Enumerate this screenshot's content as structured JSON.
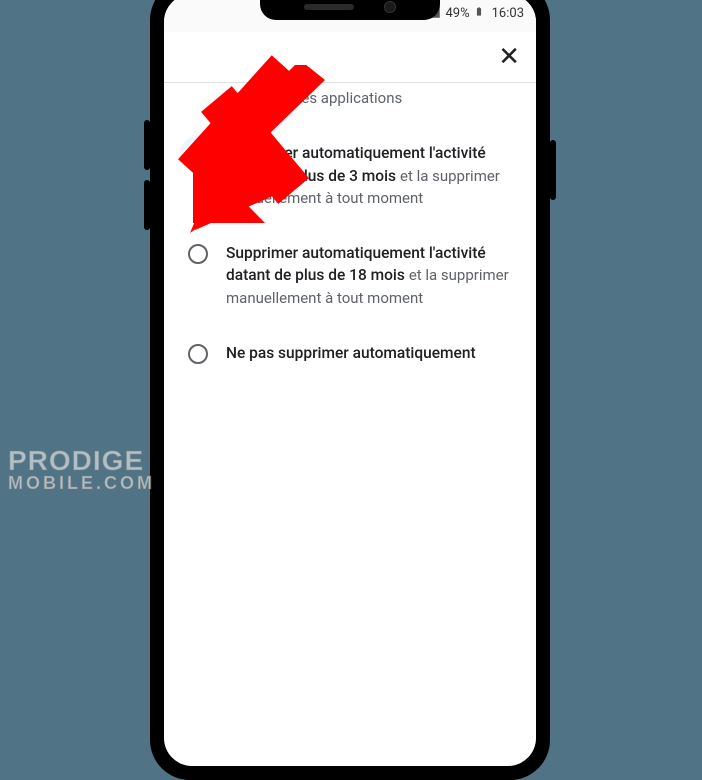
{
  "status": {
    "battery_pct": "49%",
    "time": "16:03"
  },
  "header_truncated": "les applications",
  "options": [
    {
      "title": "Supprimer automatiquement l'activité datant de plus de 3 mois",
      "sub": "et la supprimer manuellement à tout moment",
      "selected": true
    },
    {
      "title": "Supprimer automatiquement l'activité datant de plus de 18 mois",
      "sub": "et la supprimer manuellement à tout moment",
      "selected": false
    },
    {
      "title": "Ne pas supprimer automatiquement",
      "sub": "",
      "selected": false
    }
  ],
  "watermark": {
    "line1": "PRODIGE",
    "line2": "MOBILE.COM"
  }
}
